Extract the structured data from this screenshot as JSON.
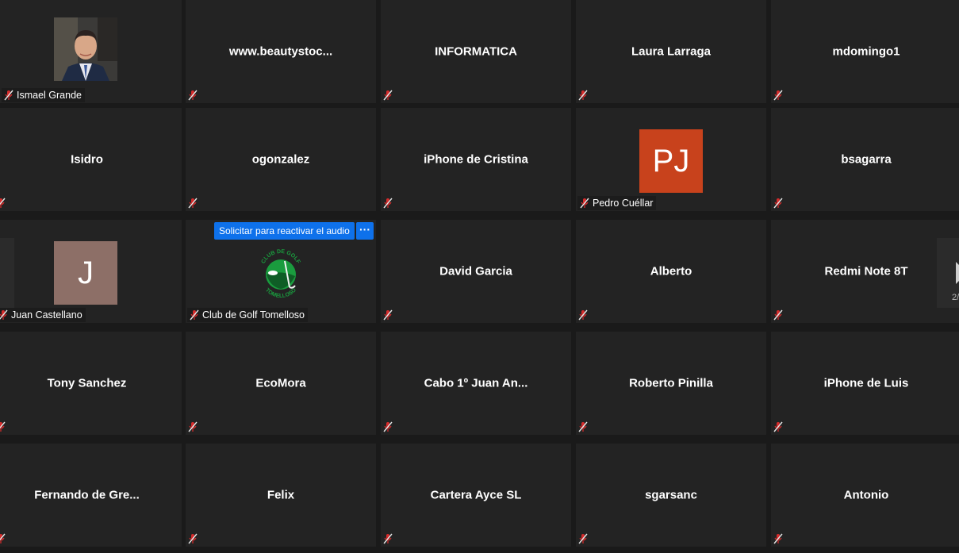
{
  "participants": [
    {
      "name": "Ismael Grande",
      "type": "photo"
    },
    {
      "name": "www.beautystoc...",
      "type": "name"
    },
    {
      "name": "INFORMATICA",
      "type": "name"
    },
    {
      "name": "Laura Larraga",
      "type": "name"
    },
    {
      "name": "mdomingo1",
      "type": "name"
    },
    {
      "name": "Isidro",
      "type": "name"
    },
    {
      "name": "ogonzalez",
      "type": "name"
    },
    {
      "name": "iPhone de Cristina",
      "type": "name"
    },
    {
      "name": "Pedro Cuéllar",
      "type": "avatar",
      "initials": "PJ",
      "avatar_color": "#c8421c"
    },
    {
      "name": "bsagarra",
      "type": "name"
    },
    {
      "name": "Juan Castellano",
      "type": "avatar",
      "initials": "J",
      "avatar_color": "#8d6f67"
    },
    {
      "name": "Club de Golf Tomelloso",
      "type": "logo"
    },
    {
      "name": "David Garcia",
      "type": "name"
    },
    {
      "name": "Alberto",
      "type": "name"
    },
    {
      "name": "Redmi Note 8T",
      "type": "name"
    },
    {
      "name": "Tony Sanchez",
      "type": "name"
    },
    {
      "name": "EcoMora",
      "type": "name"
    },
    {
      "name": "Cabo 1º Juan An...",
      "type": "name"
    },
    {
      "name": "Roberto Pinilla",
      "type": "name"
    },
    {
      "name": "iPhone de Luis",
      "type": "name"
    },
    {
      "name": "Fernando de Gre...",
      "type": "name"
    },
    {
      "name": "Felix",
      "type": "name"
    },
    {
      "name": "Cartera Ayce SL",
      "type": "name"
    },
    {
      "name": "sgarsanc",
      "type": "name"
    },
    {
      "name": "Antonio",
      "type": "name"
    }
  ],
  "logo_text": {
    "top": "CLUB DE GOLF",
    "bottom": "TOMELLOSO"
  },
  "ask_unmute_label": "Solicitar para reactivar el audio",
  "more_label": "···",
  "page_indicator": "2/",
  "icons": {
    "muted": "muted-mic-icon",
    "next": "next-page-arrow-icon"
  },
  "colors": {
    "tile_bg": "#232323",
    "muted_icon": "#e02828",
    "button": "#0e71eb",
    "logo_green": "#1a9c3e"
  }
}
